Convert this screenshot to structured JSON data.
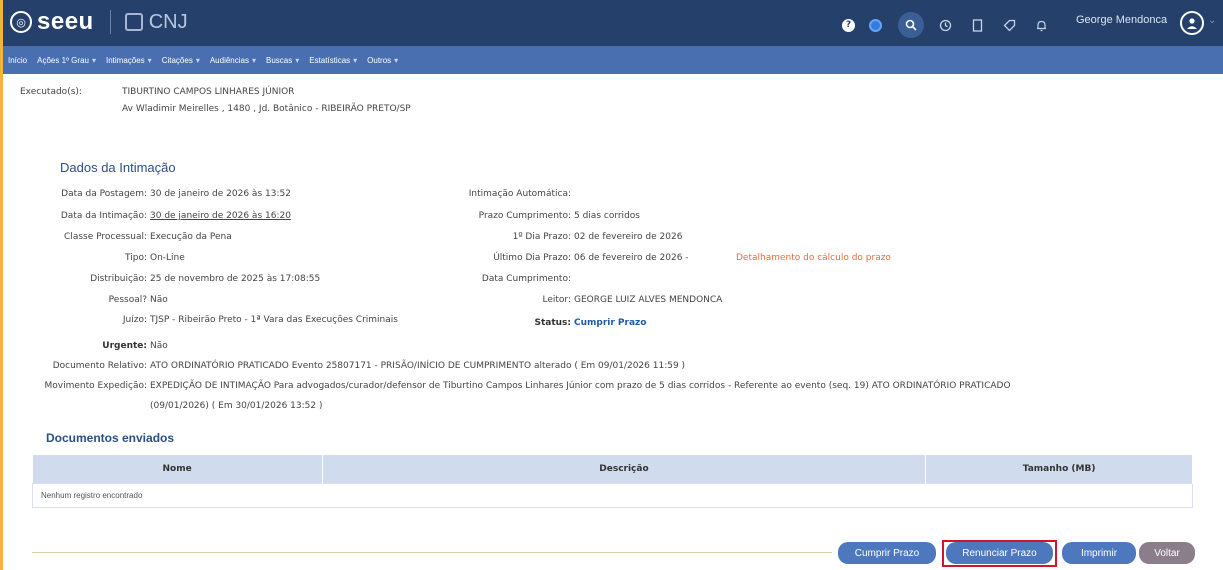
{
  "brand": {
    "logo_text": "seeu",
    "logo_glyph": "◎",
    "partner_text": "CNJ"
  },
  "topbar": {
    "icons": [
      "help-icon",
      "theme-toggle-icon",
      "search-icon",
      "history-icon",
      "bookmark-icon",
      "tag-icon",
      "notification-bell-icon"
    ],
    "user_name": "George Mendonca"
  },
  "menu": [
    {
      "label": "Início",
      "dropdown": false
    },
    {
      "label": "Ações 1º Grau",
      "dropdown": true
    },
    {
      "label": "Intimações",
      "dropdown": true
    },
    {
      "label": "Citações",
      "dropdown": true
    },
    {
      "label": "Audiências",
      "dropdown": true
    },
    {
      "label": "Buscas",
      "dropdown": true
    },
    {
      "label": "Estatísticas",
      "dropdown": true
    },
    {
      "label": "Outros",
      "dropdown": true
    }
  ],
  "executado": {
    "label": "Executado(s):",
    "name": "TIBURTINO CAMPOS LINHARES JÚNIOR",
    "address": "Av Wladimir Meirelles , 1480 , Jd. Botânico - RIBEIRÃO PRETO/SP"
  },
  "dados": {
    "title": "Dados da Intimação",
    "left": [
      {
        "label": "Data da Postagem:",
        "value": "30 de janeiro de 2026 às 13:52"
      },
      {
        "label": "Data da Intimação:",
        "value": "30 de janeiro de 2026 às 16:20"
      },
      {
        "label": "Classe Processual:",
        "value": "Execução da Pena"
      },
      {
        "label": "Tipo:",
        "value": "On-Line"
      },
      {
        "label": "Distribuição:",
        "value": "25 de novembro de 2025 às 17:08:55"
      },
      {
        "label": "Pessoal?",
        "value": "Não"
      },
      {
        "label": "Juízo:",
        "value": "TJSP - Ribeirão Preto - 1ª Vara das Execuções Criminais"
      }
    ],
    "right": [
      {
        "label": "Intimação Automática:",
        "value": ""
      },
      {
        "label": "Prazo Cumprimento:",
        "value": "5 dias corridos"
      },
      {
        "label": "1º Dia Prazo:",
        "value": "02 de fevereiro de 2026"
      },
      {
        "label": "Último Dia Prazo:",
        "value": "06 de fevereiro de 2026  -"
      },
      {
        "label": "Data Cumprimento:",
        "value": ""
      },
      {
        "label": "Leitor:",
        "value": "GEORGE LUIZ ALVES MENDONCA"
      },
      {
        "label": "Status:",
        "value": "Cumprir Prazo"
      }
    ],
    "detalhamento_link": "Detalhamento do cálculo do prazo",
    "urgente_label": "Urgente:",
    "urgente_value": "Não",
    "doc_relativo_label": "Documento Relativo:",
    "doc_relativo_value": "ATO ORDINATÓRIO PRATICADO  Evento 25807171 - PRISÃO/INÍCIO DE CUMPRIMENTO alterado  ( Em 09/01/2026 11:59 )",
    "mov_label": "Movimento Expedição:",
    "mov_line1": "EXPEDIÇÃO DE INTIMAÇÃO  Para advogados/curador/defensor de Tiburtino Campos Linhares Júnior com prazo de 5 dias corridos - Referente ao evento (seq. 19) ATO ORDINATÓRIO PRATICADO",
    "mov_line2": "(09/01/2026)  ( Em 30/01/2026 13:52 )"
  },
  "documentos": {
    "title": "Documentos enviados",
    "columns": [
      "Nome",
      "Descrição",
      "Tamanho (MB)"
    ],
    "empty_text": "Nenhum registro encontrado"
  },
  "actions": {
    "cumprir": "Cumprir Prazo",
    "renunciar": "Renunciar Prazo",
    "imprimir": "Imprimir",
    "voltar": "Voltar"
  },
  "colors": {
    "header": "#25406b",
    "menu": "#4a6fb0",
    "button": "#4e78bd",
    "highlight": "#d2132c",
    "link": "#e46d3d"
  }
}
